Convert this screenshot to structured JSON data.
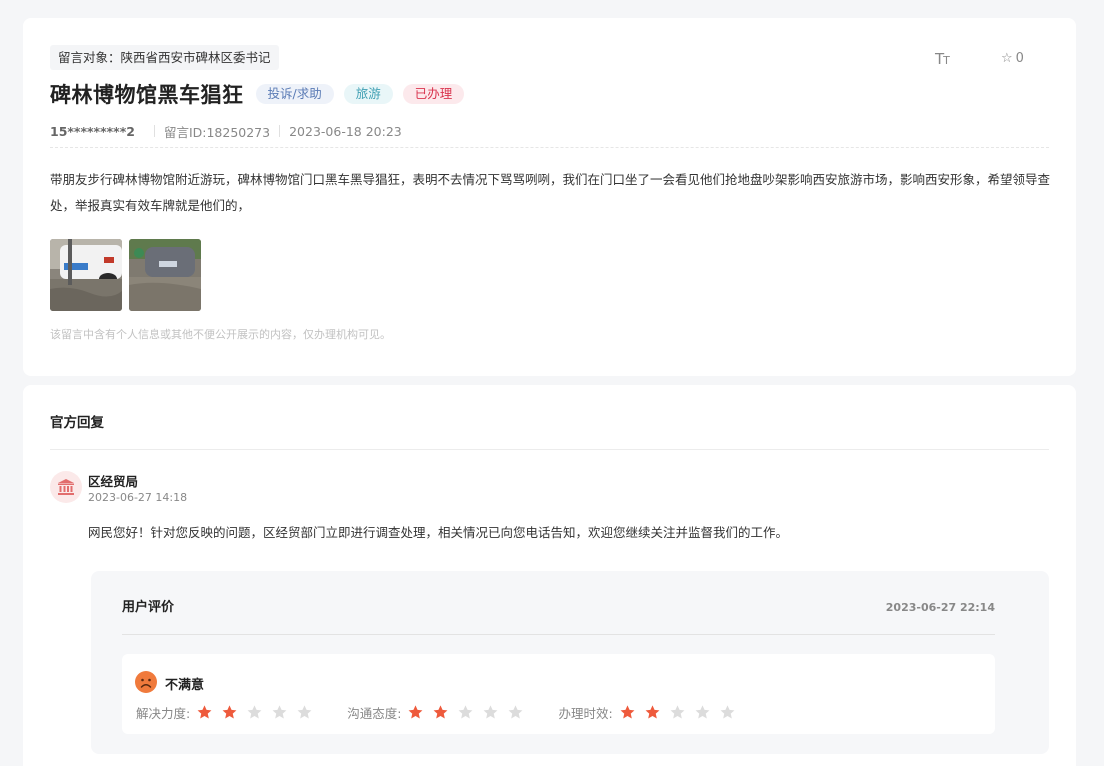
{
  "message": {
    "target": "留言对象：陕西省西安市碑林区委书记",
    "font_toggle_icon": "font-size-icon",
    "favorite_count": "0",
    "title": "碑林博物馆黑车猖狂",
    "tags": [
      "投诉/求助",
      "旅游",
      "已办理"
    ],
    "phone": "15*********2",
    "message_id": "留言ID:18250273",
    "time": "2023-06-18 20:23",
    "content": "带朋友步行碑林博物馆附近游玩，碑林博物馆门口黑车黑导猖狂，表明不去情况下骂骂咧咧，我们在门口坐了一会看见他们抢地盘吵架影响西安旅游市场，影响西安形象，希望领导查处，举报真实有效车牌就是他们的，",
    "privacy_note": "该留言中含有个人信息或其他不便公开展示的内容，仅办理机构可见。"
  },
  "reply": {
    "heading": "官方回复",
    "department": "区经贸局",
    "time": "2023-06-27 14:18",
    "text": "网民您好！针对您反映的问题，区经贸部门立即进行调查处理，相关情况已向您电话告知，欢迎您继续关注并监督我们的工作。"
  },
  "evaluation": {
    "title": "用户评价",
    "time": "2023-06-27 22:14",
    "mood": "不满意",
    "scores": [
      {
        "label": "解决力度:",
        "stars": 2,
        "max": 5
      },
      {
        "label": "沟通态度:",
        "stars": 2,
        "max": 5
      },
      {
        "label": "办理时效:",
        "stars": 2,
        "max": 5
      }
    ]
  },
  "colors": {
    "star_on": "#ee5a3c",
    "star_off": "#dcdcdc",
    "tag_done": "#d9344e"
  }
}
